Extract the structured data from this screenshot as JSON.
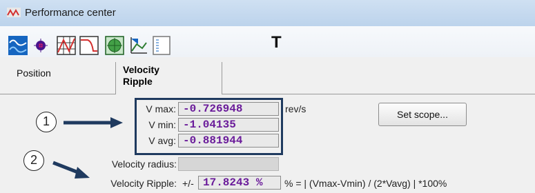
{
  "window": {
    "title": "Performance center"
  },
  "toolbar": {
    "icons": [
      "sine-wave-icon",
      "dot-target-icon",
      "grid-icon",
      "step-response-icon",
      "green-grid-icon",
      "bode-plot-icon",
      "list-view-icon"
    ],
    "extra_label": "T"
  },
  "tabs": [
    {
      "label": "Position"
    },
    {
      "label_line1": "Velocity",
      "label_line2": "Ripple"
    }
  ],
  "velocity": {
    "vmax_label": "V max:",
    "vmax_value": "-0.726948",
    "unit": "rev/s",
    "vmin_label": "V min:",
    "vmin_value": "-1.04135",
    "vavg_label": "V avg:",
    "vavg_value": "-0.881944",
    "radius_label": "Velocity radius:",
    "radius_value": "",
    "ripple_label": "Velocity Ripple:",
    "ripple_prefix": "+/-",
    "ripple_value": "17.8243 %",
    "ripple_formula": "% = | (Vmax-Vmin) / (2*Vavg) | *100%"
  },
  "buttons": {
    "set_scope": "Set scope..."
  },
  "annotations": {
    "one": "1",
    "two": "2"
  },
  "colors": {
    "value_text": "#6a1b9a",
    "highlight_border": "#1f3a5f"
  }
}
